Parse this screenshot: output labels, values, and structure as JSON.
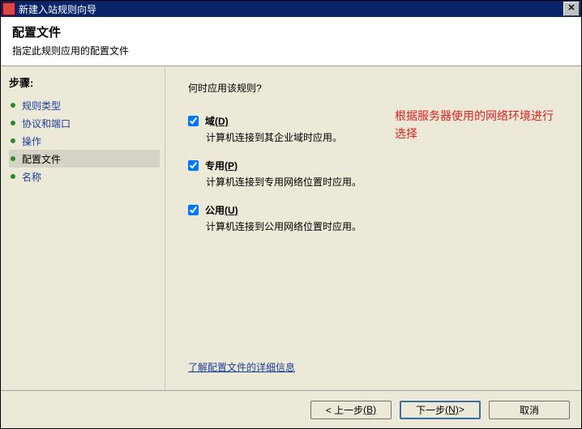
{
  "window": {
    "title": "新建入站规则向导"
  },
  "header": {
    "title": "配置文件",
    "subtitle": "指定此规则应用的配置文件"
  },
  "sidebar": {
    "steps_label": "步骤:",
    "items": [
      {
        "label": "规则类型"
      },
      {
        "label": "协议和端口"
      },
      {
        "label": "操作"
      },
      {
        "label": "配置文件"
      },
      {
        "label": "名称"
      }
    ]
  },
  "main": {
    "question": "何时应用该规则?",
    "options": [
      {
        "label_pre": "域",
        "hotkey": "(D)",
        "label_post": "",
        "desc": "计算机连接到其企业域时应用。",
        "checked": true
      },
      {
        "label_pre": "专用",
        "hotkey": "(P)",
        "label_post": "",
        "desc": "计算机连接到专用网络位置时应用。",
        "checked": true
      },
      {
        "label_pre": "公用",
        "hotkey": "(U)",
        "label_post": "",
        "desc": "计算机连接到公用网络位置时应用。",
        "checked": true
      }
    ],
    "annotation": "根据服务器使用的网络环境进行选择",
    "learn_more": "了解配置文件的详细信息"
  },
  "buttons": {
    "back_pre": "< 上一步",
    "back_hot": "(B)",
    "next_pre": "下一步",
    "next_hot": "(N)",
    "next_post": " >",
    "cancel": "取消"
  }
}
